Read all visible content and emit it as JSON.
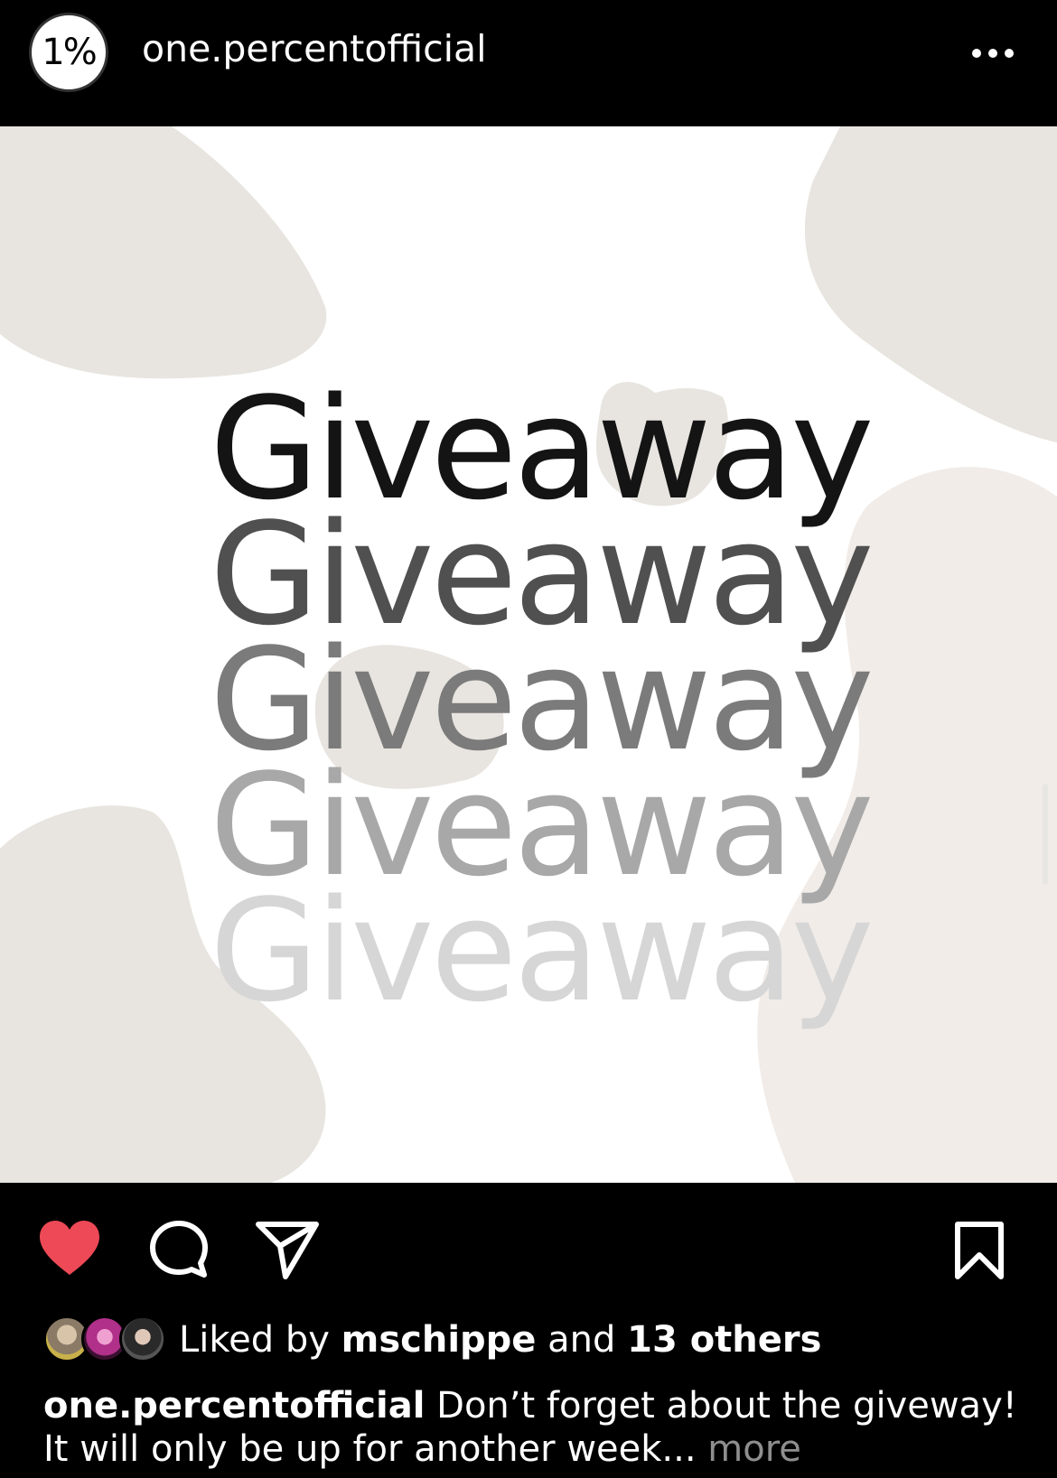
{
  "header": {
    "avatar_text": "1%",
    "username": "one.percentofficial"
  },
  "post": {
    "giveaway_lines": [
      "Giveaway",
      "Giveaway",
      "Giveaway",
      "Giveaway",
      "Giveaway"
    ],
    "giveaway_colors": [
      "#141414",
      "#505050",
      "#7b7b7b",
      "#a8a8a8",
      "#d6d6d6"
    ],
    "blob_color": "#e8e5e0",
    "blob_color_2": "#f1ece8"
  },
  "actions": {
    "like_icon": "heart-filled-icon",
    "comment_icon": "comment-icon",
    "share_icon": "paper-plane-icon",
    "save_icon": "bookmark-icon",
    "heart_color": "#ee4956"
  },
  "likes": {
    "prefix": "Liked by ",
    "user": "mschippe",
    "middle": " and ",
    "others": "13 others"
  },
  "caption": {
    "username": "one.percentofficial",
    "text": " Don’t forget about the giveway! It will only be up for another week...",
    "more": " more"
  }
}
